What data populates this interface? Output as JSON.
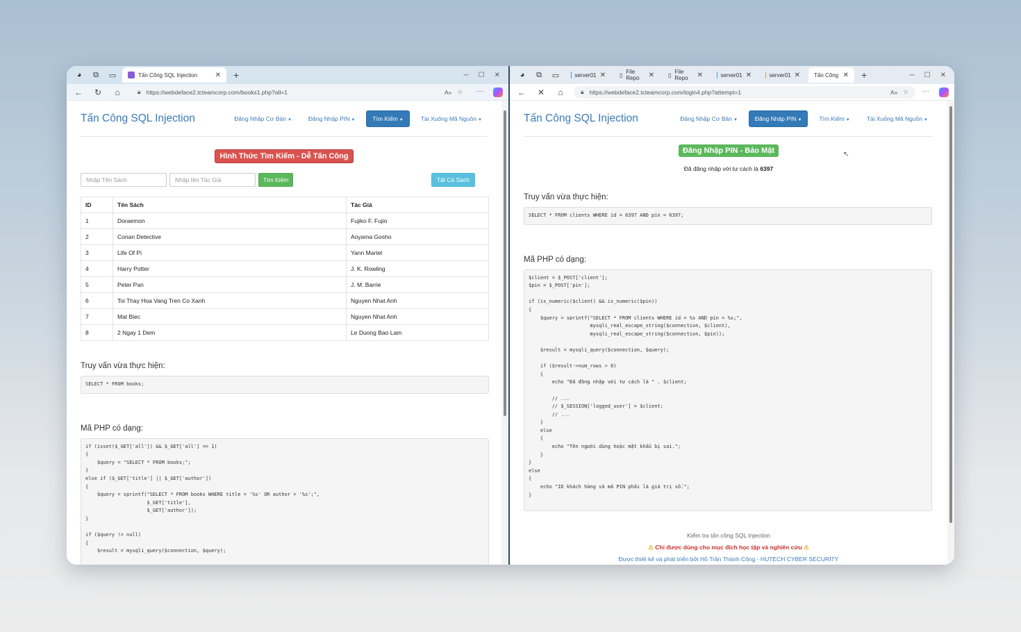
{
  "left": {
    "tab_title": "Tấn Công SQL Injection",
    "url": "https://webdeface2.tcteamcorp.com/books1.php?all=1",
    "brand": "Tấn Công SQL Injection",
    "menu": [
      {
        "label": "Đăng Nhập Cơ Bản"
      },
      {
        "label": "Đăng Nhập PIN"
      },
      {
        "label": "Tìm Kiếm"
      },
      {
        "label": "Tải Xuống Mã Nguồn"
      }
    ],
    "heading_badge": "Hình Thức Tìm Kiếm - Dễ Tấn Công",
    "search": {
      "title_placeholder": "Nhập Tên Sách",
      "author_placeholder": "Nhập tên Tác Giả",
      "search_button": "Tìm Kiếm",
      "all_button": "Tất Cả Sách"
    },
    "table": {
      "headers": [
        "ID",
        "Tên Sách",
        "Tác Giả"
      ],
      "rows": [
        [
          "1",
          "Doraemon",
          "Fujiko F. Fujio"
        ],
        [
          "2",
          "Conan Detective",
          "Aoyama Gosho"
        ],
        [
          "3",
          "Life Of Pi",
          "Yann Martel"
        ],
        [
          "4",
          "Harry Potter",
          "J. K. Rowling"
        ],
        [
          "5",
          "Peter Pan",
          "J. M. Barrie"
        ],
        [
          "6",
          "Toi Thay Hoa Vang Tren Co Xanh",
          "Nguyen Nhat Anh"
        ],
        [
          "7",
          "Mat Biec",
          "Nguyen Nhat Anh"
        ],
        [
          "8",
          "2 Ngay 1 Dem",
          "Le Duong Bao Lam"
        ]
      ]
    },
    "query_heading": "Truy vấn vừa thực hiện:",
    "query": "SELECT * FROM books;",
    "php_heading": "Mã PHP có dạng:",
    "php_code": "if (isset($_GET['all']) && $_GET['all'] == 1)\n{\n    $query = \"SELECT * FROM books;\";\n}\nelse if ($_GET['title'] || $_GET['author'])\n{\n    $query = sprintf(\"SELECT * FROM books WHERE title = '%s' OR author = '%s';\",\n                     $_GET['title'],\n                     $_GET['author']);\n}\n\nif ($query != null)\n{\n    $result = mysqli_query($connection, $query);\n\n    while (($row = mysqli_fetch_row($result)) != null)"
  },
  "right": {
    "tabs": [
      {
        "title": "server01"
      },
      {
        "title": "File Repo"
      },
      {
        "title": "File Repo"
      },
      {
        "title": "server01"
      },
      {
        "title": "server01"
      },
      {
        "title": "Tấn Công"
      }
    ],
    "url": "https://webdeface2.tcteamcorp.com/login4.php?attempt=1",
    "brand": "Tấn Công SQL Injection",
    "menu": [
      {
        "label": "Đăng Nhập Cơ Bản"
      },
      {
        "label": "Đăng Nhập PIN"
      },
      {
        "label": "Tìm Kiếm"
      },
      {
        "label": "Tải Xuống Mã Nguồn"
      }
    ],
    "heading_badge": "Đăng Nhập PIN - Bảo Mật",
    "logged_in_text": "Đã đăng nhập với tư cách là",
    "logged_in_id": "6397",
    "query_heading": "Truy vấn vừa thực hiện:",
    "query": "SELECT * FROM clients WHERE id = 6397 AND pin = 6397;",
    "php_heading": "Mã PHP có dạng:",
    "php_code": "$client = $_POST['client'];\n$pin = $_POST['pin'];\n\nif (is_numeric($client) && is_numeric($pin))\n{\n    $query = sprintf(\"SELECT * FROM clients WHERE id = %s AND pin = %s;\",\n                     mysqli_real_escape_string($connection, $client),\n                     mysqli_real_escape_string($connection, $pin));\n\n    $result = mysqli_query($connection, $query);\n\n    if ($result->num_rows > 0)\n    {\n        echo \"Đã đăng nhập với tư cách là \" . $client;\n\n        // ...\n        // $_SESSION['logged_user'] = $client;\n        // ...\n    }\n    else\n    {\n        echo \"Tên người dùng hoặc mật khẩu bị sai.\";\n    }\n}\nelse\n{\n    echo \"ID khách hàng và mã PIN phải là giá trị số.\";\n}",
    "footer_title": "Kiểm tra tấn công SQL Injection",
    "footer_warning": "Chỉ được dùng cho mục đích học tập và nghiên cứu",
    "footer_credit": "Được thiết kế và phát triển bởi Hồ Trần Thành Công - HUTECH CYBER SECURITY"
  },
  "colors": {
    "brand": "#3a7ab8",
    "primary": "#337ab7",
    "danger": "#d9534f",
    "success": "#5cb85c",
    "info": "#5bc0de",
    "warning_text": "#c9302c"
  }
}
